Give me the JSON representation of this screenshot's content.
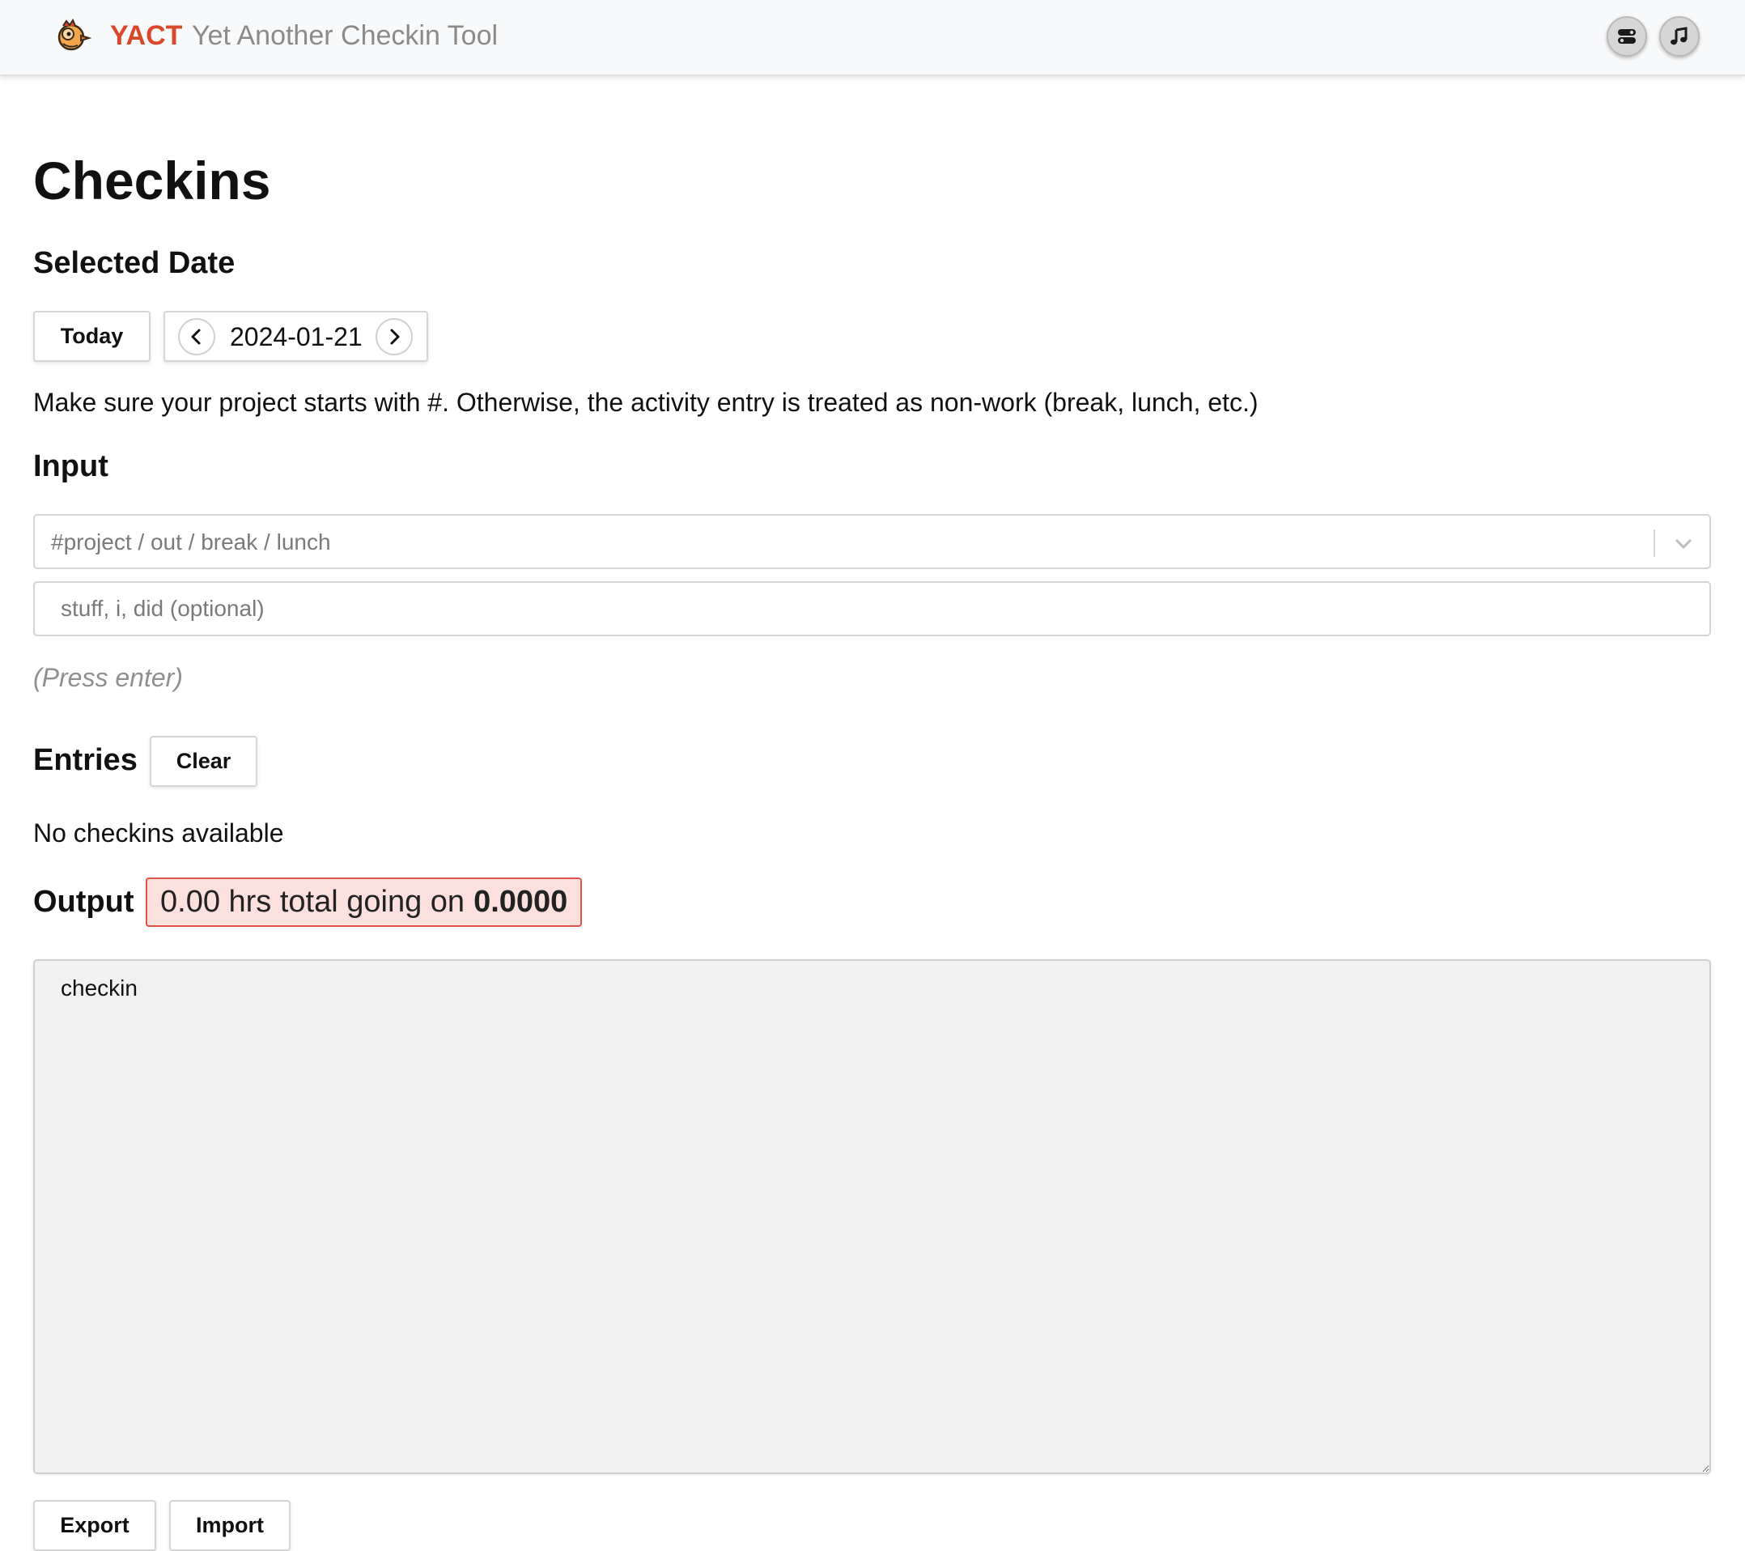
{
  "header": {
    "app_name": "YACT",
    "tagline": "Yet Another Checkin Tool",
    "logo_icon": "bird-logo-icon",
    "settings_icon": "toggle-settings-icon",
    "music_icon": "music-note-icon"
  },
  "page": {
    "title": "Checkins"
  },
  "selected_date": {
    "heading": "Selected Date",
    "today_label": "Today",
    "date_value": "2024-01-21",
    "prev_icon": "chevron-left-icon",
    "next_icon": "chevron-right-icon"
  },
  "info_text": "Make sure your project starts with #. Otherwise, the activity entry is treated as non-work (break, lunch, etc.)",
  "input": {
    "heading": "Input",
    "project_placeholder": "#project / out / break / lunch",
    "description_placeholder": "stuff, i, did (optional)",
    "hint": "(Press enter)",
    "dropdown_icon": "chevron-down-icon"
  },
  "entries": {
    "heading": "Entries",
    "clear_label": "Clear",
    "empty_message": "No checkins available"
  },
  "output": {
    "heading": "Output",
    "total_prefix": "0.00 hrs total going on",
    "total_value": "0.0000",
    "text": "checkin"
  },
  "footer": {
    "export_label": "Export",
    "import_label": "Import"
  },
  "colors": {
    "brand": "#d9482b",
    "badge_bg": "#fbe0de",
    "badge_border": "#e4534a"
  }
}
